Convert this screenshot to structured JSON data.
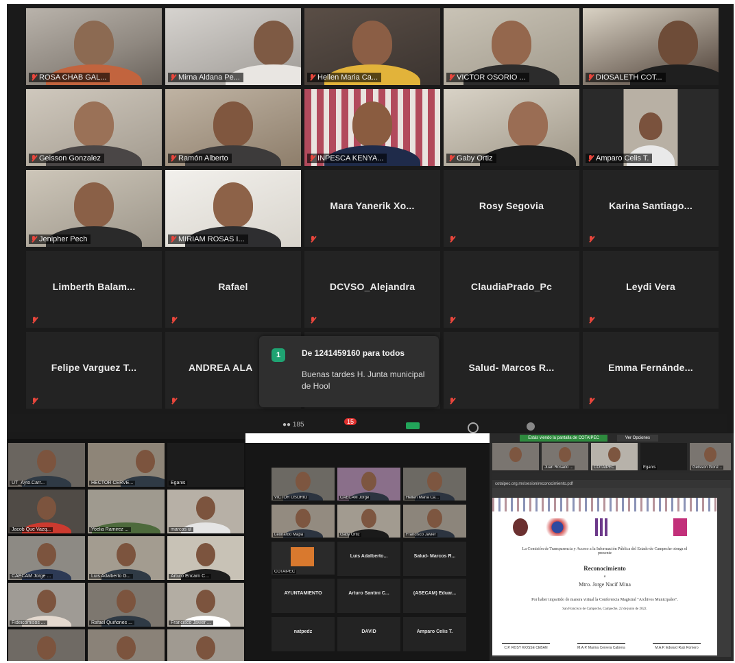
{
  "meeting": {
    "video_tiles": [
      {
        "name": "ROSA CHAB GAL..."
      },
      {
        "name": "Mirna Aldana Pe..."
      },
      {
        "name": "Hellen Maria Ca..."
      },
      {
        "name": "VICTOR OSORIO ..."
      },
      {
        "name": "DIOSALETH COT..."
      },
      {
        "name": "Geisson Gonzalez"
      },
      {
        "name": "Ramón Alberto"
      },
      {
        "name": "INPESCA KENYA..."
      },
      {
        "name": "Gaby Ortiz"
      },
      {
        "name": "Amparo Celis T."
      },
      {
        "name": "Jenipher Pech"
      },
      {
        "name": "MIRIAM ROSAS I..."
      }
    ],
    "name_tiles": [
      {
        "name": "Mara Yanerik Xo..."
      },
      {
        "name": "Rosy Segovia"
      },
      {
        "name": "Karina Santiago..."
      },
      {
        "name": "Limberth Balam..."
      },
      {
        "name": "Rafael"
      },
      {
        "name": "DCVSO_Alejandra"
      },
      {
        "name": "ClaudiaPrado_Pc"
      },
      {
        "name": "Leydi Vera"
      },
      {
        "name": "Felipe Varguez T..."
      },
      {
        "name": "ANDREA ALA"
      },
      {
        "name": ""
      },
      {
        "name": "Salud- Marcos R..."
      },
      {
        "name": "Emma Fernánde..."
      }
    ],
    "chat_popup": {
      "badge": "1",
      "from": "De 1241459160 para todos",
      "message": "Buenas tardes H. Junta municipal de Hool"
    },
    "toolbar": {
      "participants": "185",
      "chat_count": "15"
    }
  },
  "bottom_left": {
    "tiles": [
      {
        "name": "UT_Ayto.Carr..."
      },
      {
        "name": "HECTOR CERVE..."
      },
      {
        "name": "Eganis"
      },
      {
        "name": "Jacob Que Vazq..."
      },
      {
        "name": "Yoelia Ramirez ..."
      },
      {
        "name": "marcos ul"
      },
      {
        "name": "CAECAM Jorge ..."
      },
      {
        "name": "Luis Adalberto G..."
      },
      {
        "name": "Arturo Encarn C..."
      },
      {
        "name": "Fideicomisos ..."
      },
      {
        "name": "Rafael Quiñones ..."
      },
      {
        "name": "Francisco Javier ..."
      }
    ]
  },
  "bottom_mid": {
    "video_tiles": [
      {
        "name": "VICTOR OSORIO"
      },
      {
        "name": "CAECAM Jorge"
      },
      {
        "name": "Hellen Maria Ca..."
      },
      {
        "name": "Leonardo Mapa"
      },
      {
        "name": "Gaby Ortiz"
      },
      {
        "name": "Francisco Javier"
      },
      {
        "name": "COTAIPEC"
      }
    ],
    "name_tiles": [
      {
        "name": "Luis Adalberto..."
      },
      {
        "name": "Salud- Marcos R..."
      },
      {
        "name": "AYUNTAMIENTO"
      },
      {
        "name": "Arturo Santini C..."
      },
      {
        "name": "(ASECAM) Eduar..."
      },
      {
        "name": "natpedz"
      },
      {
        "name": "DAVID"
      },
      {
        "name": "Amparo Celis T."
      }
    ]
  },
  "bottom_right": {
    "banner": "Estás viendo la pantalla de COTAIPEC",
    "view_options": "Ver Opciones",
    "tiles": [
      {
        "name": "Juan Rosado ..."
      },
      {
        "name": "COTAIPEC"
      },
      {
        "name": "Eganis"
      },
      {
        "name": "Geisson Gonz..."
      }
    ],
    "browser": {
      "url": "cotaipec.org.mx/sesion/reconocimiento.pdf",
      "certificate": {
        "intro": "La Comisión de Transparencia y Acceso a la Información Pública del Estado de Campeche otorga el presente",
        "title": "Reconocimiento",
        "a": "a",
        "recipient": "Mtro. Jorge Nacif Mina",
        "reason": "Por haber impartido de manera virtual la Conferencia Magistral \"Archivos Municipales\".",
        "place_date": "San Francisco de Campeche, Campeche, 22 de junio de 2022.",
        "signatures": [
          {
            "name": "C.P. ROSY KIOSSE CEBAN"
          },
          {
            "name": "M.A.P. Marina Cervera Cabrera"
          },
          {
            "name": "M.A.P. Edward Ruiz Romero"
          }
        ]
      }
    }
  }
}
